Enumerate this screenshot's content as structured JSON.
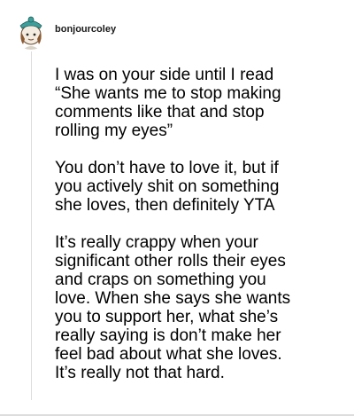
{
  "post": {
    "username": "bonjourcoley",
    "avatar_icon": "cartoon-character-avatar-icon",
    "paragraphs": [
      "I was on your side until I read\n“She wants me to stop making\ncomments like that and stop\nrolling my eyes”",
      "You don’t have to love it, but if\nyou actively shit on something\nshe loves, then definitely YTA",
      "It’s really crappy when your\nsignificant other rolls their eyes\nand craps on something you\nlove. When she says she wants\nyou to support her, what she’s\nreally saying is don’t make her\nfeel bad about what she loves.\nIt’s really not that hard."
    ]
  },
  "colors": {
    "background": "#ffffff",
    "text": "#000000",
    "divider": "#dddddd",
    "avatar_hat": "#3d9e9a"
  }
}
